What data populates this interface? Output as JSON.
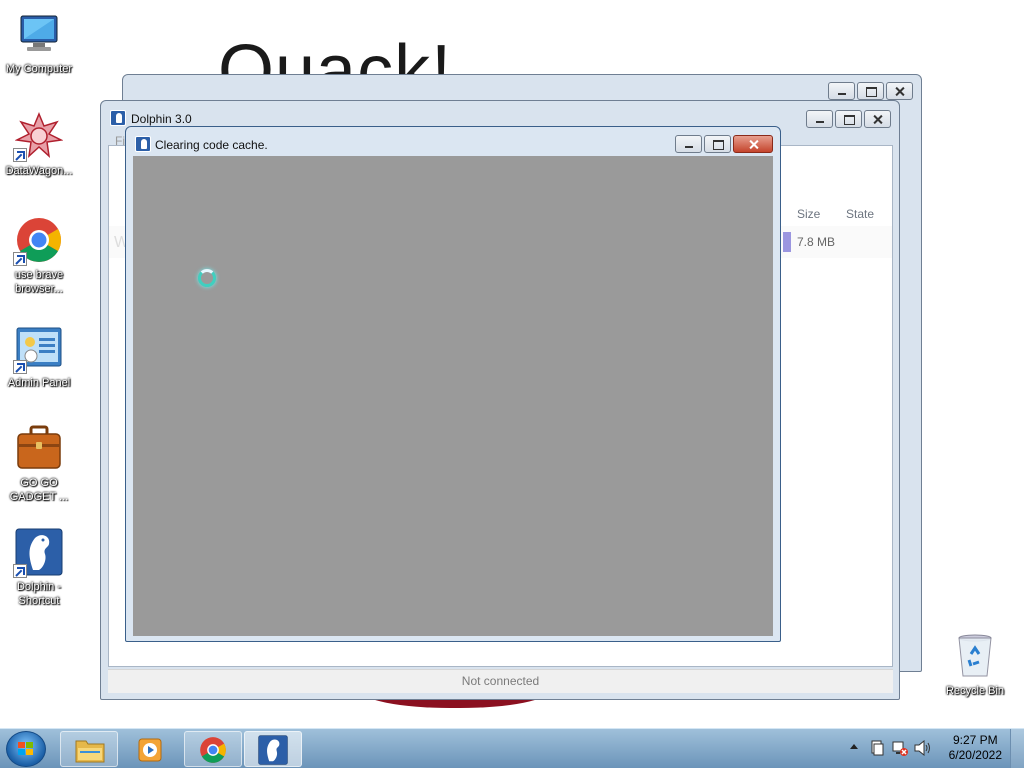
{
  "wallpaper": {
    "text": "Quack!"
  },
  "desktop_icons": [
    {
      "label": "My Computer",
      "icon": "computer-icon"
    },
    {
      "label": "DataWagon...",
      "icon": "datawagon-icon"
    },
    {
      "label": "use brave browser...",
      "icon": "chrome-icon"
    },
    {
      "label": "Admin Panel",
      "icon": "admin-panel-icon"
    },
    {
      "label": "GO GO GADGET ...",
      "icon": "briefcase-icon"
    },
    {
      "label": "Dolphin - Shortcut",
      "icon": "dolphin-icon"
    },
    {
      "label": "Recycle Bin",
      "icon": "recycle-bin-icon"
    }
  ],
  "dolphin_window": {
    "title": "Dolphin 3.0",
    "menu_fragment": "Fi",
    "columns": {
      "size": "Size",
      "state": "State"
    },
    "row": {
      "name_fragment": "W",
      "size": "7.8 MB"
    },
    "status": "Not connected"
  },
  "cache_dialog": {
    "title": "Clearing code cache."
  },
  "taskbar": {
    "pinned": [
      {
        "name": "Windows Explorer",
        "icon": "folder-icon"
      },
      {
        "name": "Windows Media Player",
        "icon": "media-player-icon"
      },
      {
        "name": "Google Chrome",
        "icon": "chrome-icon"
      },
      {
        "name": "Dolphin",
        "icon": "dolphin-icon",
        "active": true
      }
    ],
    "time": "9:27 PM",
    "date": "6/20/2022"
  }
}
